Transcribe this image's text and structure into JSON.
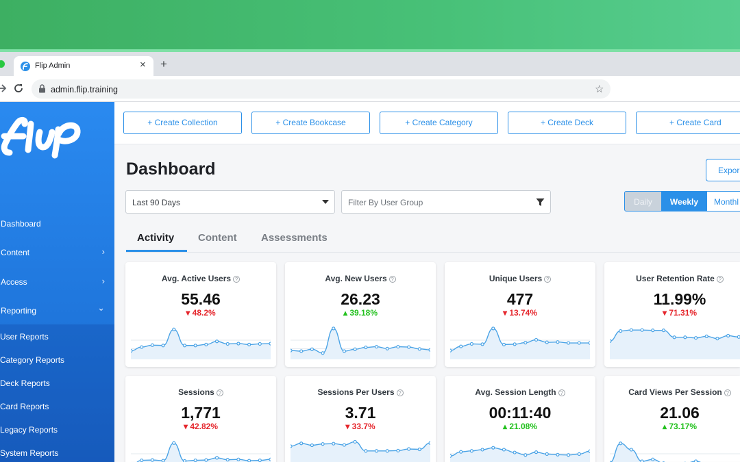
{
  "browser": {
    "tab_title": "Flip Admin",
    "tab_close": "×",
    "new_tab": "+",
    "url": "admin.flip.training",
    "icons": [
      "favicon-icon",
      "close-icon",
      "plus-icon",
      "forward-icon",
      "reload-icon",
      "lock-icon",
      "star-icon"
    ]
  },
  "sidebar": {
    "logo_text": "flip",
    "items": [
      {
        "label": "Dashboard",
        "chevron": ""
      },
      {
        "label": "Content",
        "chevron": "›"
      },
      {
        "label": "Access",
        "chevron": "›"
      },
      {
        "label": "Reporting",
        "chevron": "⌄"
      }
    ],
    "sub_items": [
      {
        "label": "User Reports"
      },
      {
        "label": "Category Reports"
      },
      {
        "label": "Deck Reports"
      },
      {
        "label": "Card Reports"
      },
      {
        "label": "Legacy Reports"
      },
      {
        "label": "System Reports"
      }
    ]
  },
  "actions": {
    "create_collection": "+ Create Collection",
    "create_bookcase": "+ Create Bookcase",
    "create_category": "+ Create Category",
    "create_deck": "+ Create Deck",
    "create_card": "+ Create Card"
  },
  "page": {
    "title": "Dashboard",
    "export_label": "Expor"
  },
  "filters": {
    "range": "Last 90 Days",
    "user_group_placeholder": "Filter By User Group"
  },
  "period": {
    "daily": "Daily",
    "weekly": "Weekly",
    "monthly": "Monthl",
    "selected": "Weekly"
  },
  "content_tabs": {
    "activity": "Activity",
    "content": "Content",
    "assessments": "Assessments",
    "selected": "Activity"
  },
  "help_glyph": "?",
  "colors": {
    "accent": "#2b90e8",
    "down": "#e5262c",
    "up": "#23c11e",
    "sidebar": "#2a8af0",
    "spark_line": "#4aa3e6",
    "spark_fill": "#e6f1fb"
  },
  "cards": [
    {
      "title": "Avg. Active Users",
      "value": "55.46",
      "change": "▾ 48.2%",
      "direction": "down",
      "spark": [
        0.14,
        0.26,
        0.32,
        0.31,
        0.82,
        0.31,
        0.31,
        0.34,
        0.44,
        0.36,
        0.37,
        0.34,
        0.36,
        0.37
      ]
    },
    {
      "title": "Avg. New Users",
      "value": "26.23",
      "change": "▴ 39.18%",
      "direction": "up",
      "spark": [
        0.15,
        0.13,
        0.19,
        0.07,
        0.85,
        0.13,
        0.19,
        0.25,
        0.27,
        0.21,
        0.27,
        0.26,
        0.2,
        0.17
      ]
    },
    {
      "title": "Unique Users",
      "value": "477",
      "change": "▾ 13.74%",
      "direction": "down",
      "spark": [
        0.15,
        0.28,
        0.36,
        0.35,
        0.85,
        0.34,
        0.35,
        0.4,
        0.49,
        0.41,
        0.42,
        0.39,
        0.39,
        0.39
      ]
    },
    {
      "title": "User Retention Rate",
      "value": "11.99%",
      "change": "▾ 71.31%",
      "direction": "down",
      "spark": [
        0.45,
        0.77,
        0.8,
        0.8,
        0.79,
        0.79,
        0.57,
        0.57,
        0.55,
        0.6,
        0.53,
        0.62,
        0.58,
        0.6
      ]
    },
    {
      "title": "Sessions",
      "value": "1,771",
      "change": "▾ 42.82%",
      "direction": "down",
      "spark": [
        0.1,
        0.27,
        0.28,
        0.26,
        0.82,
        0.25,
        0.27,
        0.28,
        0.35,
        0.29,
        0.3,
        0.26,
        0.27,
        0.3
      ]
    },
    {
      "title": "Sessions Per Users",
      "value": "3.71",
      "change": "▾ 33.7%",
      "direction": "down",
      "spark": [
        0.72,
        0.81,
        0.75,
        0.79,
        0.8,
        0.76,
        0.86,
        0.57,
        0.57,
        0.57,
        0.58,
        0.63,
        0.62,
        0.82
      ]
    },
    {
      "title": "Avg. Session Length",
      "value": "00:11:40",
      "change": "▴ 21.08%",
      "direction": "up",
      "spark": [
        0.41,
        0.54,
        0.57,
        0.61,
        0.67,
        0.61,
        0.52,
        0.44,
        0.53,
        0.47,
        0.45,
        0.44,
        0.47,
        0.56
      ]
    },
    {
      "title": "Card Views Per Session",
      "value": "21.06",
      "change": "▴ 73.17%",
      "direction": "up",
      "spark": [
        0.2,
        0.81,
        0.61,
        0.24,
        0.3,
        0.18,
        0.14,
        0.17,
        0.24,
        0.15,
        0.15,
        0.05,
        0.06,
        0.03
      ]
    }
  ]
}
